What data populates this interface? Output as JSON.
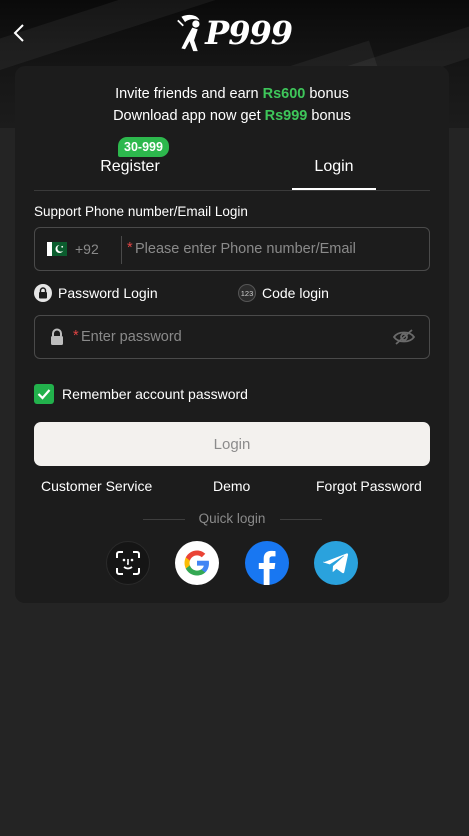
{
  "header": {
    "logo_text": "P999",
    "back_icon": "chevron-left-icon"
  },
  "invite": {
    "line1_prefix": "Invite friends and earn ",
    "line1_amount": "Rs600",
    "line1_suffix": " bonus",
    "line2_prefix": "Download app now get ",
    "line2_amount": "Rs999",
    "line2_suffix": " bonus"
  },
  "tabs": {
    "register_label": "Register",
    "register_badge": "30-999",
    "login_label": "Login",
    "active": "Login"
  },
  "form": {
    "section_label": "Support Phone number/Email Login",
    "country_code": "+92",
    "country_flag": "pakistan-flag-icon",
    "phone_placeholder": "Please enter Phone number/Email",
    "required_mark": "*",
    "password_login_label": "Password Login",
    "code_login_label": "Code login",
    "code_icon_text": "123",
    "password_placeholder": "Enter password",
    "remember_label": "Remember account password",
    "remember_checked": true,
    "login_button": "Login"
  },
  "links": {
    "customer_service": "Customer Service",
    "demo": "Demo",
    "forgot_password": "Forgot Password"
  },
  "quick_login": {
    "label": "Quick login",
    "providers": [
      "face-id-icon",
      "google-icon",
      "facebook-icon",
      "telegram-icon"
    ]
  },
  "colors": {
    "accent_green": "#3ec65a",
    "badge_green": "#2db84d",
    "checkbox_green": "#22b14c",
    "card_bg": "#1c1c1c",
    "page_bg": "#242424",
    "required_red": "#e24444"
  }
}
